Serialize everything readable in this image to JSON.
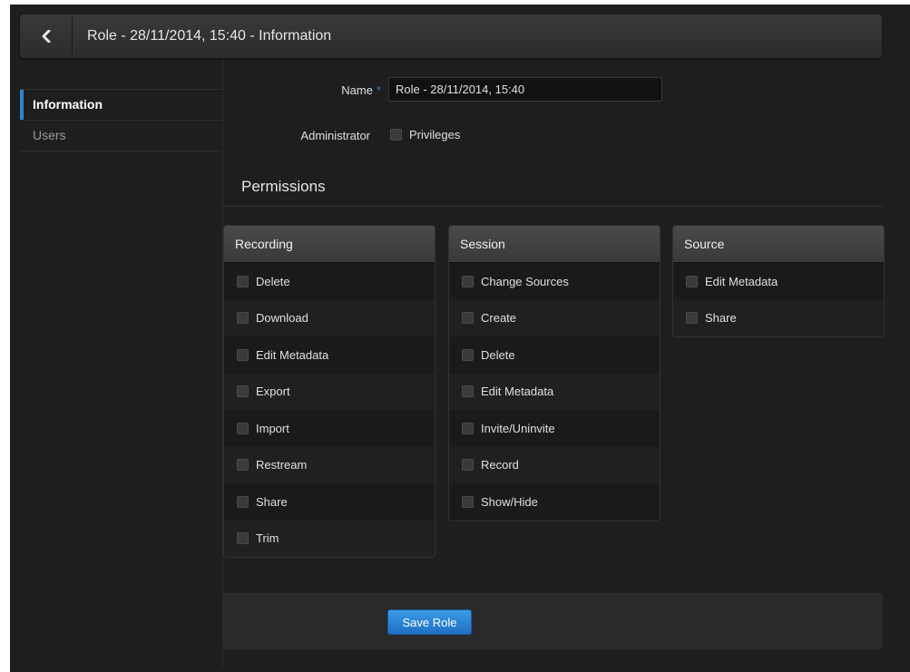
{
  "header": {
    "title": "Role - 28/11/2014, 15:40 - Information"
  },
  "sidebar": {
    "items": [
      {
        "label": "Information",
        "active": true
      },
      {
        "label": "Users",
        "active": false
      }
    ]
  },
  "form": {
    "name_label": "Name",
    "name_required_mark": "*",
    "name_value": "Role - 28/11/2014, 15:40",
    "admin_label": "Administrator",
    "admin_checkbox_label": "Privileges",
    "admin_checked": false
  },
  "permissions": {
    "title": "Permissions",
    "groups": [
      {
        "name": "Recording",
        "items": [
          "Delete",
          "Download",
          "Edit Metadata",
          "Export",
          "Import",
          "Restream",
          "Share",
          "Trim"
        ]
      },
      {
        "name": "Session",
        "items": [
          "Change Sources",
          "Create",
          "Delete",
          "Edit Metadata",
          "Invite/Uninvite",
          "Record",
          "Show/Hide"
        ]
      },
      {
        "name": "Source",
        "items": [
          "Edit Metadata",
          "Share"
        ]
      }
    ]
  },
  "footer": {
    "save_label": "Save Role"
  },
  "colors": {
    "accent": "#2e84d3",
    "background": "#1e1e1e",
    "panel_header": "#3f3f3f"
  }
}
